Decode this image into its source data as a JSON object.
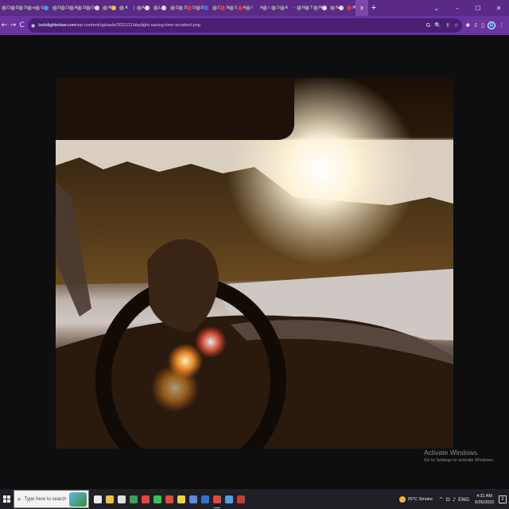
{
  "browser": {
    "tabs": [
      {
        "letter": "D",
        "color": "#8a8a8a"
      },
      {
        "letter": "D",
        "color": "#8a8a8a"
      },
      {
        "letter": "D",
        "color": "#8a8a8a"
      },
      {
        "letter": "a",
        "color": "#8a8a8a"
      },
      {
        "letter": "G",
        "color": "#8a8a8a"
      },
      {
        "letter": "",
        "color": "#3aa0d8"
      },
      {
        "letter": "D",
        "color": "#8a8a8a"
      },
      {
        "letter": "D",
        "color": "#8a8a8a"
      },
      {
        "letter": "A",
        "color": "#8a8a8a"
      },
      {
        "letter": "D",
        "color": "#8a8a8a"
      },
      {
        "letter": "D",
        "color": "#8a8a8a"
      },
      {
        "letter": "",
        "color": "#d8d8d8"
      },
      {
        "letter": "M",
        "color": "#8a8a8a"
      },
      {
        "letter": "",
        "color": "#e8c23a"
      },
      {
        "letter": "A",
        "color": "#8a8a8a"
      },
      {
        "letter": "|",
        "color": "#5b2a86"
      },
      {
        "letter": "A",
        "color": "#8a8a8a"
      },
      {
        "letter": "",
        "color": "#e0e0e0"
      },
      {
        "letter": "L",
        "color": "#8a8a8a"
      },
      {
        "letter": "",
        "color": "#e0e0e0"
      },
      {
        "letter": "D",
        "color": "#8a8a8a"
      },
      {
        "letter": "D",
        "color": "#8a8a8a"
      },
      {
        "letter": "D",
        "color": "#d23a3a"
      },
      {
        "letter": "D",
        "color": "#8a8a8a"
      },
      {
        "letter": "",
        "color": "#3a6fd8"
      },
      {
        "letter": "C",
        "color": "#8a8a8a"
      },
      {
        "letter": "N",
        "color": "#d23a3a"
      },
      {
        "letter": "S",
        "color": "#8a8a8a"
      },
      {
        "letter": "A",
        "color": "#d23a3a"
      },
      {
        "letter": "I",
        "color": "#8a8a8a"
      },
      {
        "letter": "A",
        "color": "#5b2a86"
      },
      {
        "letter": "l",
        "color": "#8a8a8a"
      },
      {
        "letter": "D",
        "color": "#8a8a8a"
      },
      {
        "letter": "A",
        "color": "#8a8a8a"
      },
      {
        "letter": "-",
        "color": "#5b2a86"
      },
      {
        "letter": "H",
        "color": "#8a8a8a"
      },
      {
        "letter": "T",
        "color": "#8a8a8a"
      },
      {
        "letter": "M",
        "color": "#8a8a8a"
      },
      {
        "letter": "",
        "color": "#e0e0e0"
      },
      {
        "letter": "N",
        "color": "#8a8a8a"
      },
      {
        "letter": "",
        "color": "#e0e0e0"
      },
      {
        "letter": "M",
        "color": "#d23a3a"
      }
    ],
    "active_tab_label": "x",
    "new_tab_label": "+",
    "window_controls": {
      "dropdown": "⌄",
      "minimize": "–",
      "maximize": "☐",
      "close": "✕"
    },
    "nav": {
      "back": "←",
      "forward": "→",
      "reload": "C"
    },
    "url_domain": "lockdighterlaw.com",
    "url_path": "/wp-content/uploads/2021/11/daylight-saving-time-accident.png",
    "omnibox_icons": [
      "G",
      "🔍",
      "⇪",
      "☆"
    ],
    "toolbar_icons": [
      "✱",
      "⇩",
      "▯"
    ],
    "profile_initial": "G"
  },
  "watermark": {
    "title": "Activate Windows",
    "subtitle": "Go to Settings to activate Windows."
  },
  "taskbar": {
    "search_placeholder": "Type here to search",
    "search_icon": "⌕",
    "apps": [
      {
        "name": "task-view",
        "color": "#e8e8e8"
      },
      {
        "name": "file-explorer",
        "color": "#f2c13a"
      },
      {
        "name": "store",
        "color": "#e0e0e0"
      },
      {
        "name": "edge",
        "color": "#3aa05a"
      },
      {
        "name": "chrome",
        "color": "#e04a3a"
      },
      {
        "name": "whatsapp",
        "color": "#35c05a"
      },
      {
        "name": "chrome-2",
        "color": "#e04a3a"
      },
      {
        "name": "sticky-notes",
        "color": "#f2d23a"
      },
      {
        "name": "app-generic",
        "color": "#5a8ad8"
      },
      {
        "name": "chrome-profile",
        "color": "#2f6fd6"
      },
      {
        "name": "chrome-active",
        "color": "#e04a3a"
      },
      {
        "name": "app-blue",
        "color": "#4aa0e0"
      },
      {
        "name": "app-red",
        "color": "#c83a3a"
      }
    ],
    "weather_text": "25°C  Smoke",
    "tray_icons": [
      "^",
      "⊡",
      "♪",
      "ENG"
    ],
    "time": "4:31 AM",
    "date": "9/26/2023",
    "notification_count": "2"
  },
  "photo_description_colors": {
    "sun": "#fff6dc",
    "dash": "#1c120a",
    "snow": "#cfc7c4"
  }
}
